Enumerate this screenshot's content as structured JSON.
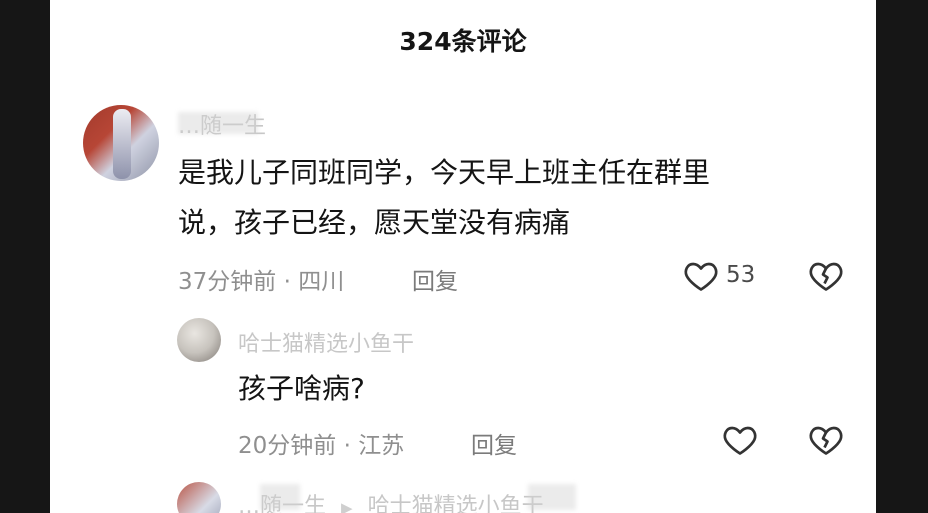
{
  "header": {
    "title": "324条评论"
  },
  "comments": [
    {
      "username": "…随一生",
      "text_lines": [
        "是我儿子同班同学，今天早上班主任在群里",
        "说，孩子已经，愿天堂没有病痛"
      ],
      "meta": "37分钟前 · 四川",
      "reply_label": "回复",
      "like_count": "53",
      "replies": [
        {
          "username": "哈士猫精选小鱼干",
          "text": "孩子啥病?",
          "meta": "20分钟前 · 江苏",
          "reply_label": "回复"
        }
      ]
    }
  ],
  "partial_reply": {
    "username": "…随一生",
    "reply_to": "哈士猫精选小鱼干"
  },
  "icons": [
    "heart-outline-icon",
    "broken-heart-icon",
    "play-triangle-icon"
  ],
  "colors": {
    "panel_bg": "#ffffff",
    "backdrop": "#161616",
    "text_primary": "#141414",
    "text_secondary": "#8f8f8f"
  }
}
